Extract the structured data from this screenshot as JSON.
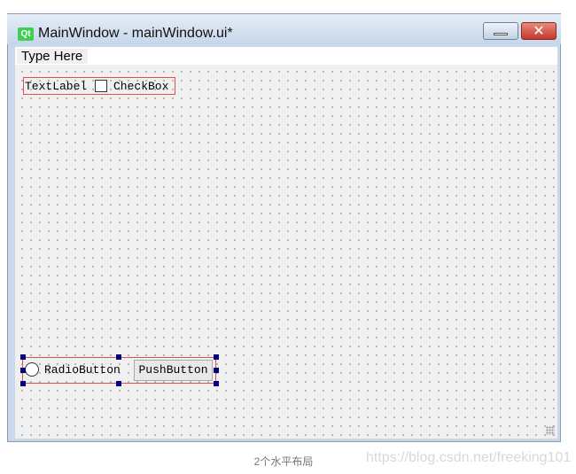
{
  "window": {
    "title": "MainWindow - mainWindow.ui*",
    "logo_text": "Qt",
    "close_glyph": "✕"
  },
  "menubar": {
    "placeholder_item": "Type Here"
  },
  "form": {
    "layout1": {
      "label_text": "TextLabel",
      "checkbox_label": "CheckBox"
    },
    "layout2": {
      "radio_label": "RadioButton",
      "push_button_label": "PushButton"
    }
  },
  "caption": "2个水平布局",
  "watermark": "https://blog.csdn.net/freeking101",
  "colors": {
    "layout_border": "#e05050",
    "selection_handle": "#000080",
    "qt_logo": "#41cd52",
    "close_button": "#c2392a"
  },
  "icons": [
    "qt-logo-icon",
    "minimize-icon",
    "close-icon",
    "size-grip-icon"
  ]
}
